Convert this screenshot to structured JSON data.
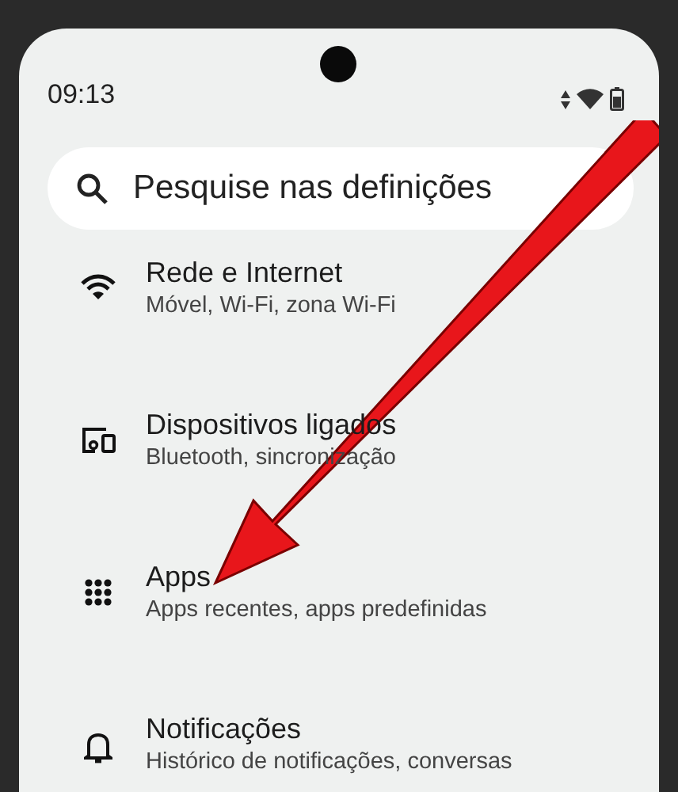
{
  "status_bar": {
    "time": "09:13"
  },
  "search": {
    "placeholder": "Pesquise nas definições"
  },
  "settings": [
    {
      "title": "Rede e Internet",
      "subtitle": "Móvel, Wi-Fi, zona Wi-Fi"
    },
    {
      "title": "Dispositivos ligados",
      "subtitle": "Bluetooth, sincronização"
    },
    {
      "title": "Apps",
      "subtitle": "Apps recentes, apps predefinidas"
    },
    {
      "title": "Notificações",
      "subtitle": "Histórico de notificações, conversas"
    }
  ]
}
